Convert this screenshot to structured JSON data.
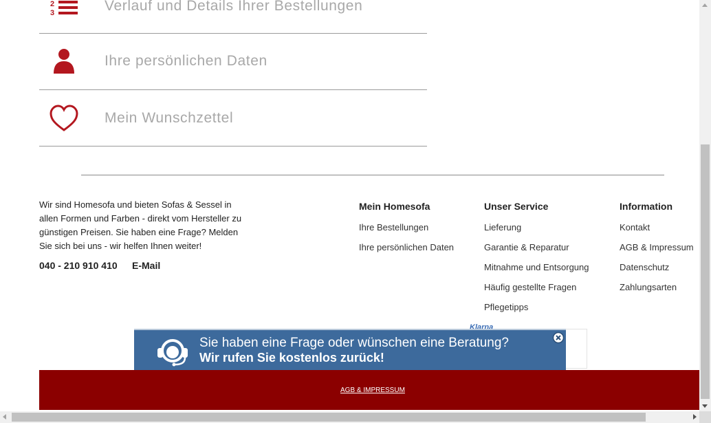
{
  "account_menu": {
    "items": [
      {
        "label": "Verlauf und Details Ihrer Bestellungen",
        "icon": "order-list-icon"
      },
      {
        "label": "Ihre persönlichen Daten",
        "icon": "user-icon"
      },
      {
        "label": "Mein Wunschzettel",
        "icon": "heart-icon"
      }
    ]
  },
  "footer": {
    "about_text": "Wir sind Homesofa und bieten Sofas & Sessel in allen Formen und Farben - direkt vom Hersteller zu günstigen Preisen. Sie haben eine Frage? Melden Sie sich bei uns - wir helfen Ihnen weiter!",
    "phone": "040 - 210 910 410",
    "email_label": "E-Mail",
    "columns": [
      {
        "title": "Mein Homesofa",
        "links": [
          "Ihre Bestellungen",
          "Ihre persönlichen Daten"
        ]
      },
      {
        "title": "Unser Service",
        "links": [
          "Lieferung",
          "Garantie & Reparatur",
          "Mitnahme und Entsorgung",
          "Häufig gestellte Fragen",
          "Pflegetipps"
        ]
      },
      {
        "title": "Information",
        "links": [
          "Kontakt",
          "AGB & Impressum",
          "Datenschutz",
          "Zahlungsarten"
        ]
      }
    ],
    "klarna_text": "Klarna",
    "bottom_link": "AGB & IMPRESSUM"
  },
  "callback_banner": {
    "line1": "Sie haben eine Frage oder wünschen eine Beratung?",
    "line2": "Wir rufen Sie kostenlos zurück!"
  },
  "colors": {
    "accent_red": "#b3171f",
    "footer_red": "#8b0000",
    "banner_blue": "#3d6a9c"
  }
}
